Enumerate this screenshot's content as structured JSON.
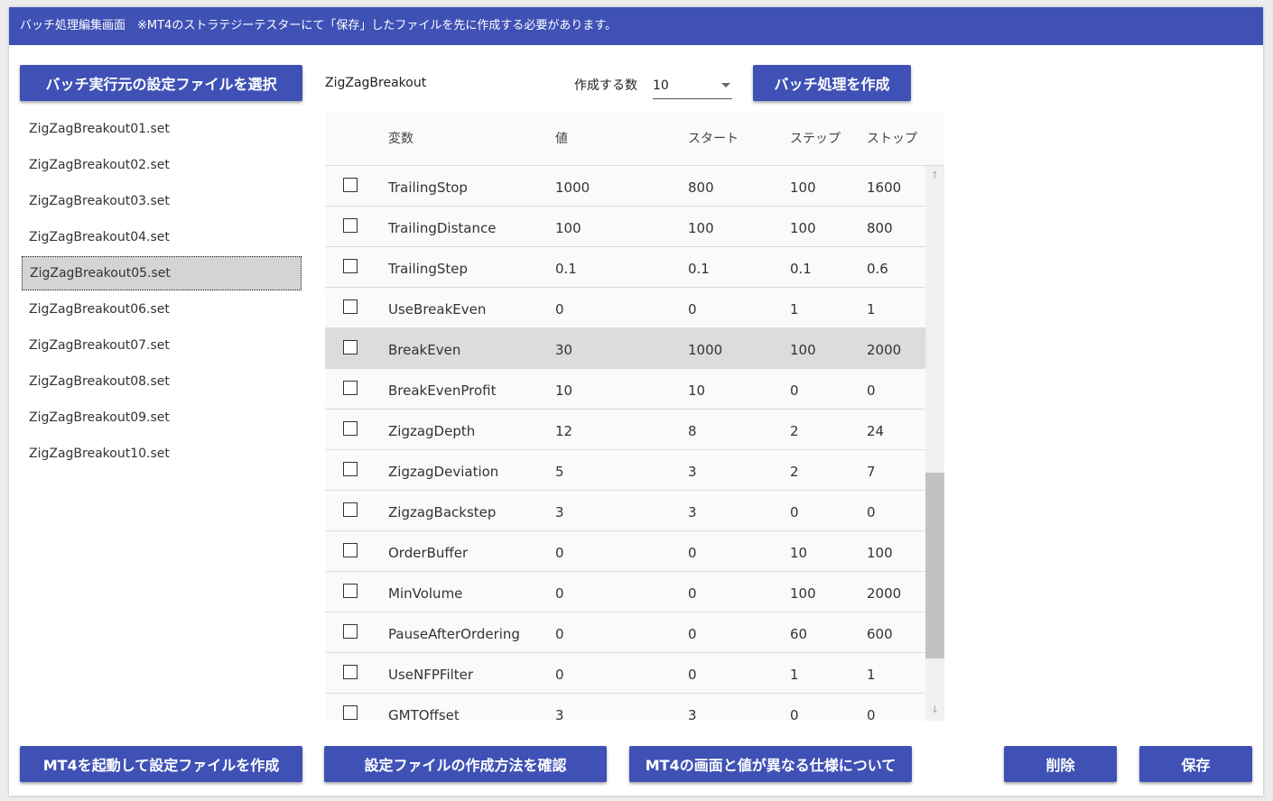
{
  "window": {
    "title": "バッチ処理編集画面　※MT4のストラテジーテスターにて「保存」したファイルを先に作成する必要があります。"
  },
  "toolbar": {
    "select_source_label": "バッチ実行元の設定ファイルを選択",
    "source_name": "ZigZagBreakout",
    "count_label": "作成する数",
    "count_value": "10",
    "create_batch_label": "バッチ処理を作成"
  },
  "files": [
    "ZigZagBreakout01.set",
    "ZigZagBreakout02.set",
    "ZigZagBreakout03.set",
    "ZigZagBreakout04.set",
    "ZigZagBreakout05.set",
    "ZigZagBreakout06.set",
    "ZigZagBreakout07.set",
    "ZigZagBreakout08.set",
    "ZigZagBreakout09.set",
    "ZigZagBreakout10.set"
  ],
  "grid": {
    "headers": [
      "変数",
      "値",
      "スタート",
      "ステップ",
      "ストップ"
    ],
    "rows": [
      [
        "TrailingStop",
        "1000",
        "800",
        "100",
        "1600"
      ],
      [
        "TrailingDistance",
        "100",
        "100",
        "100",
        "800"
      ],
      [
        "TrailingStep",
        "0.1",
        "0.1",
        "0.1",
        "0.6"
      ],
      [
        "UseBreakEven",
        "0",
        "0",
        "1",
        "1"
      ],
      [
        "BreakEven",
        "30",
        "1000",
        "100",
        "2000"
      ],
      [
        "BreakEvenProfit",
        "10",
        "10",
        "0",
        "0"
      ],
      [
        "ZigzagDepth",
        "12",
        "8",
        "2",
        "24"
      ],
      [
        "ZigzagDeviation",
        "5",
        "3",
        "2",
        "7"
      ],
      [
        "ZigzagBackstep",
        "3",
        "3",
        "0",
        "0"
      ],
      [
        "OrderBuffer",
        "0",
        "0",
        "10",
        "100"
      ],
      [
        "MinVolume",
        "0",
        "0",
        "100",
        "2000"
      ],
      [
        "PauseAfterOrdering",
        "0",
        "0",
        "60",
        "600"
      ],
      [
        "UseNFPFilter",
        "0",
        "0",
        "1",
        "1"
      ],
      [
        "GMTOffset",
        "3",
        "3",
        "0",
        "0"
      ]
    ]
  },
  "footer": {
    "launch_mt4_label": "MT4を起動して設定ファイルを作成",
    "howto_label": "設定ファイルの作成方法を確認",
    "spec_label": "MT4の画面と値が異なる仕様について",
    "delete_label": "削除",
    "save_label": "保存"
  },
  "colors": {
    "accent": "#3f51b5",
    "selected_bg": "#d4d4d4",
    "highlight_row_bg": "#dcdcdc"
  }
}
